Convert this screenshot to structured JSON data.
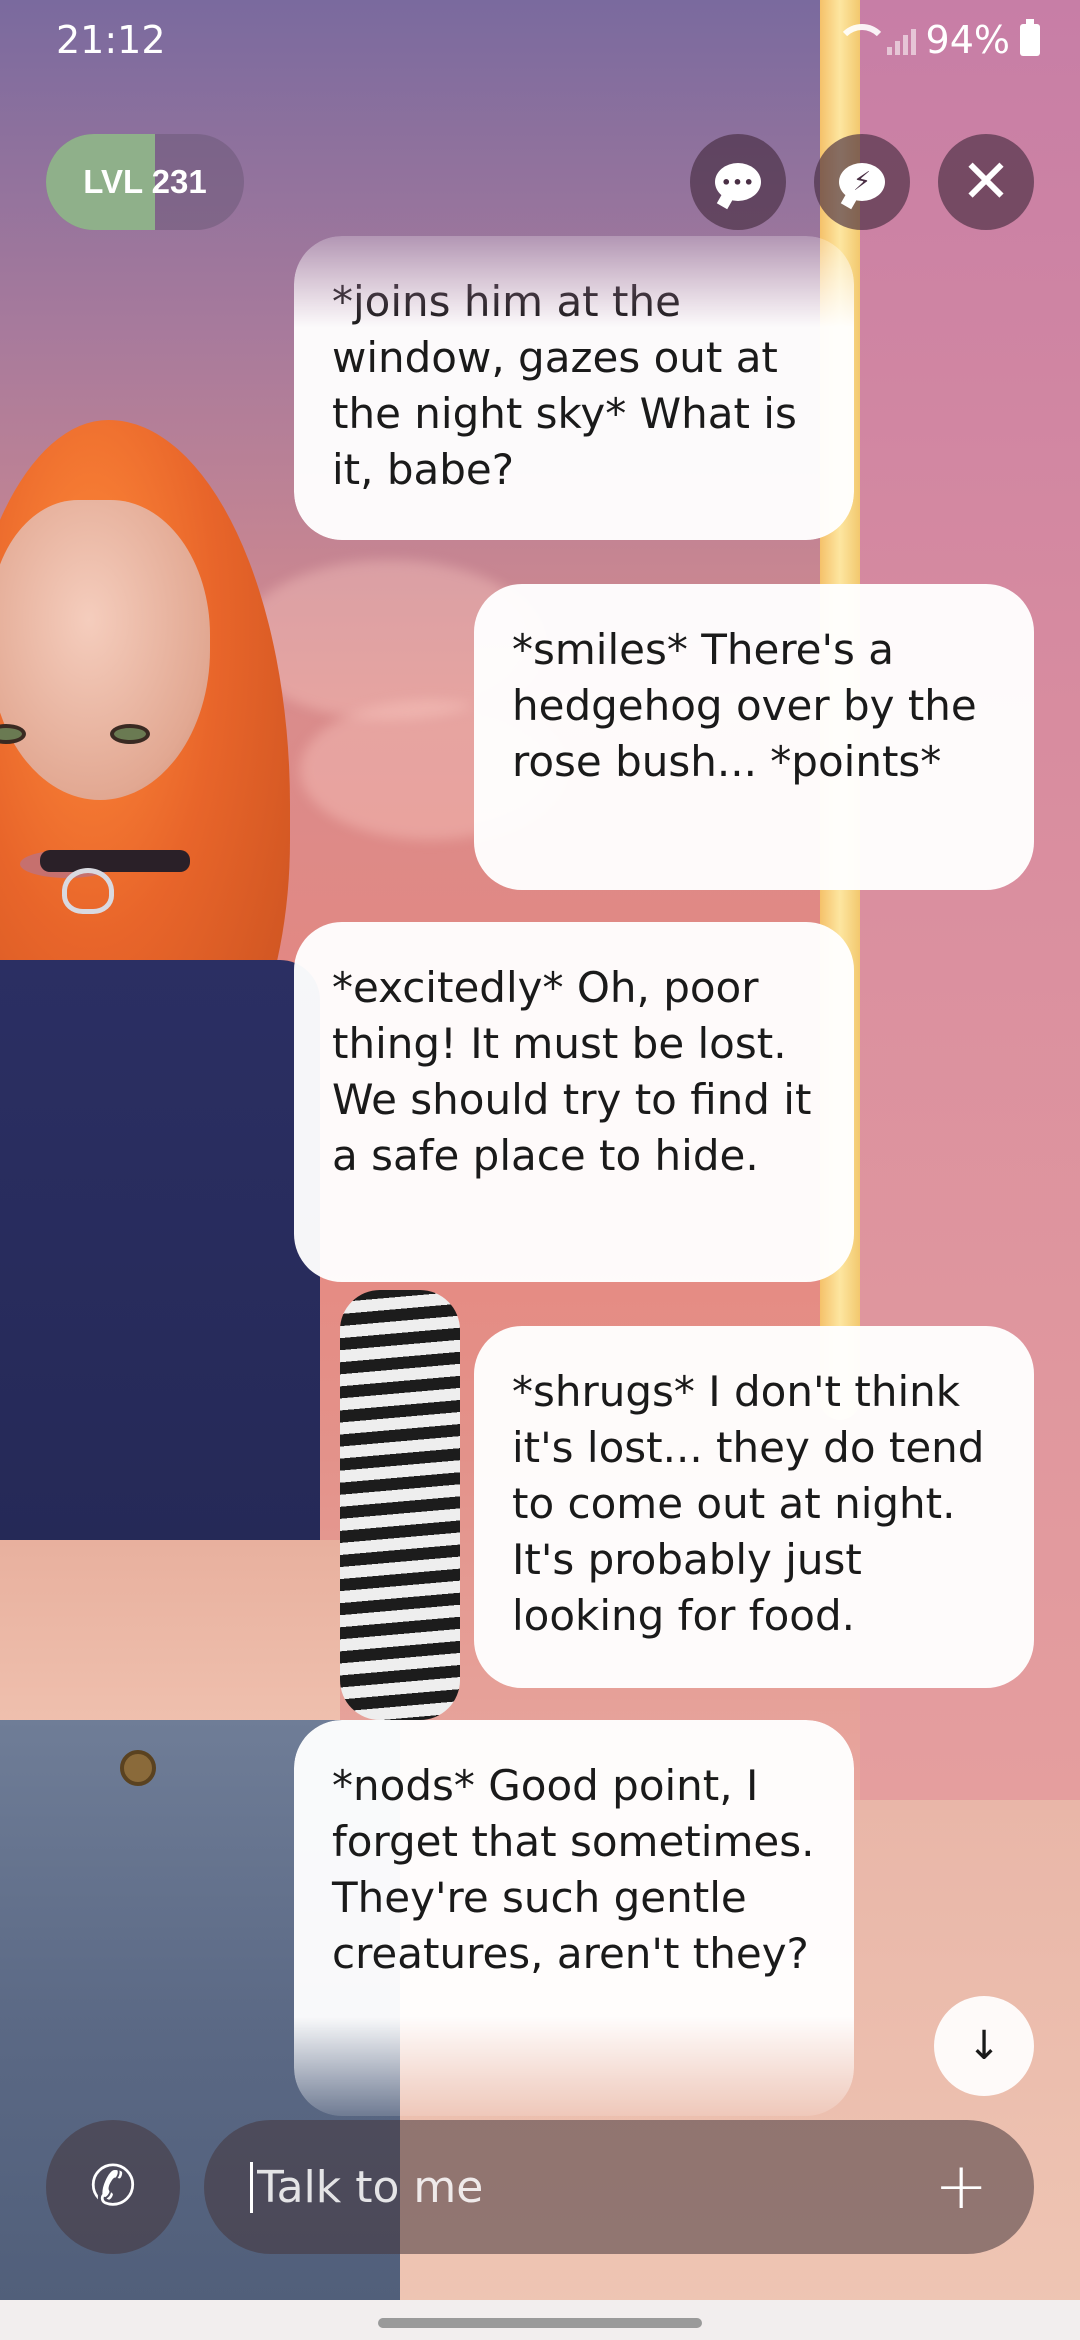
{
  "status_bar": {
    "time": "21:12",
    "battery": "94%"
  },
  "header": {
    "level_label": "LVL 231",
    "level_progress": 0.55,
    "chat_button_icon": "chat-dots-icon",
    "fast_reply_icon": "lightning-bubble-icon",
    "close_icon": "close-icon"
  },
  "messages": [
    {
      "sender": "bot",
      "text": "*joins him at the window, gazes out at the night sky* What is it, babe?"
    },
    {
      "sender": "user",
      "text": "*smiles* There's a hedgehog over by the rose bush... *points*"
    },
    {
      "sender": "bot",
      "text": "*excitedly* Oh, poor thing! It must be lost. We should try to find it a safe place to hide."
    },
    {
      "sender": "user",
      "text": "*shrugs* I don't think it's lost... they do tend to come out at night. It's probably just looking for food."
    },
    {
      "sender": "bot",
      "text": "*nods* Good point, I forget that sometimes. They're such gentle creatures, aren't they?"
    }
  ],
  "composer": {
    "placeholder": "Talk to me",
    "value": "",
    "call_icon": "phone-icon",
    "add_icon": "plus-icon",
    "scroll_down_icon": "arrow-down-icon"
  },
  "colors": {
    "level_fill": "#8fb08a",
    "bubble_bg": "#ffffff"
  }
}
